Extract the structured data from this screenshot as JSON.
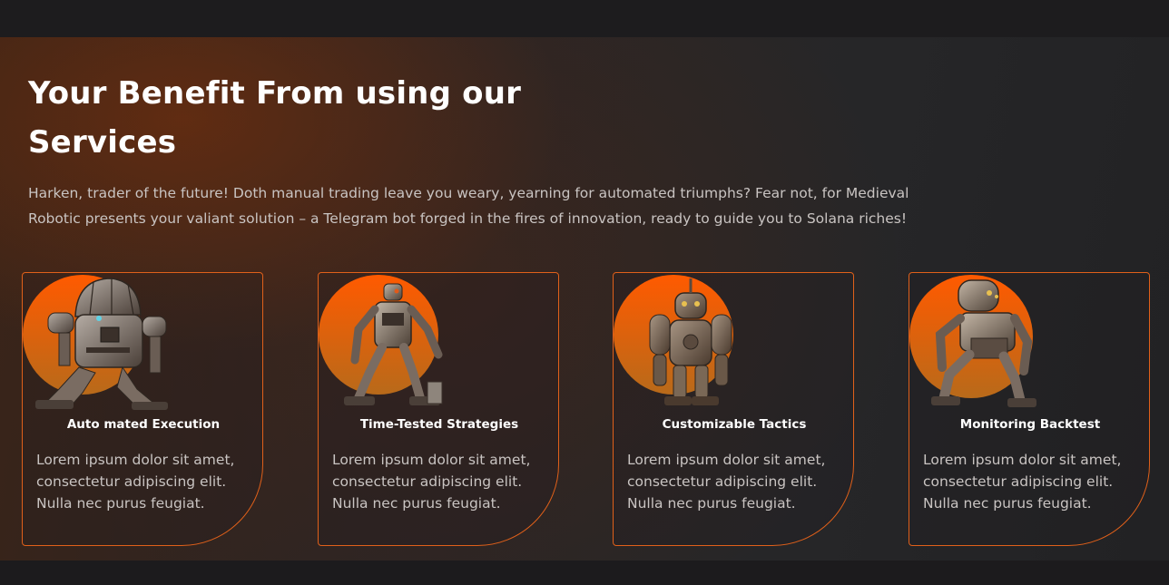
{
  "section": {
    "heading": "Your Benefit From using our Services",
    "intro": "Harken, trader of the future! Doth manual trading leave you weary, yearning for automated triumphs? Fear not, for Medieval Robotic presents your valiant solution – a Telegram bot forged in the fires of innovation, ready to guide you to Solana riches!"
  },
  "cards": [
    {
      "title": "Auto mated Execution",
      "description": "Lorem ipsum dolor sit amet, consectetur adipiscing elit. Nulla nec purus feugiat.",
      "icon": "robot-round-helmet-icon"
    },
    {
      "title": "Time-Tested Strategies",
      "description": "Lorem ipsum dolor sit amet, consectetur adipiscing elit. Nulla nec purus feugiat.",
      "icon": "robot-walker-icon"
    },
    {
      "title": "Customizable Tactics",
      "description": "Lorem ipsum dolor sit amet, consectetur adipiscing elit. Nulla nec purus feugiat.",
      "icon": "robot-standing-icon"
    },
    {
      "title": "Monitoring Backtest",
      "description": "Lorem ipsum dolor sit amet, consectetur adipiscing elit. Nulla nec purus feugiat.",
      "icon": "robot-crouching-icon"
    }
  ],
  "colors": {
    "accent": "#e0601a",
    "circle_top": "#ff5a00",
    "circle_bottom": "#b86a1a",
    "heading": "#ffffff",
    "body_text": "#c9c4c2"
  }
}
